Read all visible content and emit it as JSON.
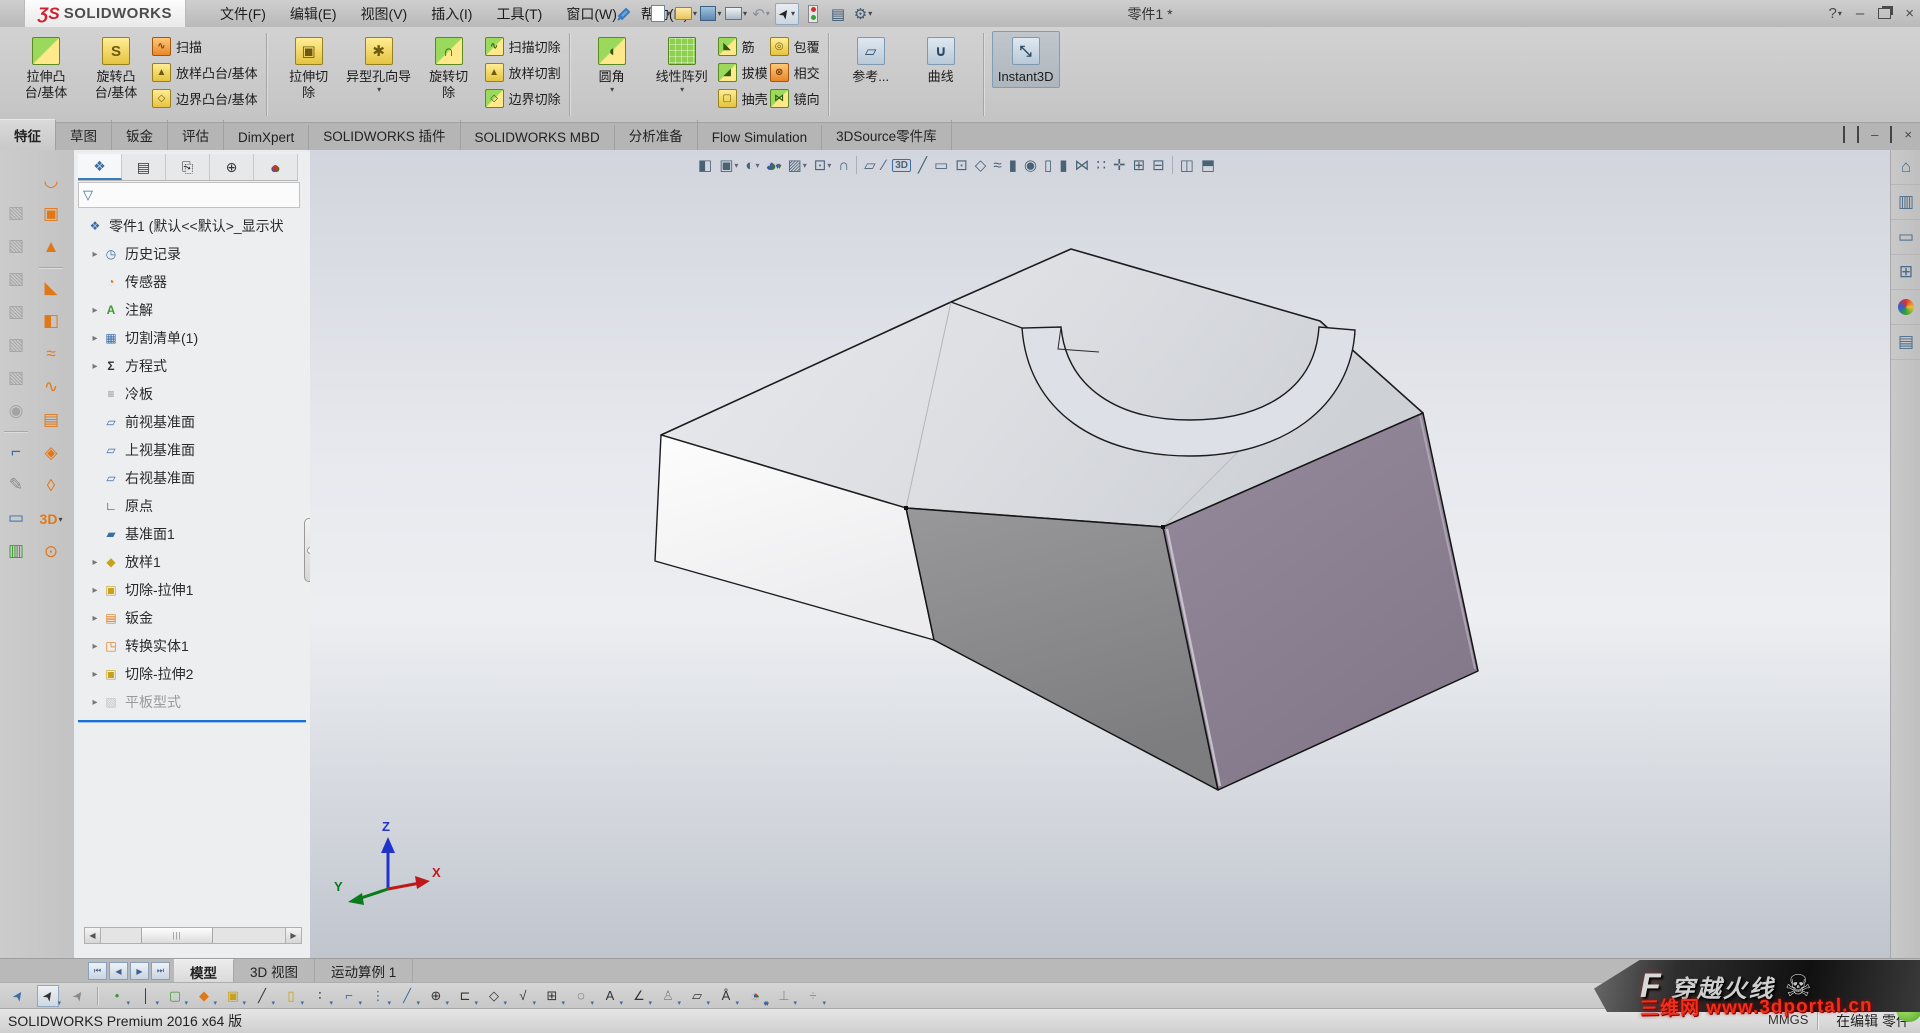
{
  "titlebar": {
    "logo_mark": "ƷS",
    "logo_text": "SOLIDWORKS",
    "menus": [
      "文件(F)",
      "编辑(E)",
      "视图(V)",
      "插入(I)",
      "工具(T)",
      "窗口(W)",
      "帮助(H)"
    ],
    "document_title": "零件1 *",
    "help_label": "?",
    "minimize_label": "–",
    "close_label": "×"
  },
  "quick_access": [
    {
      "n": "new-document-button",
      "c": "qi-new",
      "shape": true,
      "caret": true
    },
    {
      "n": "open-button",
      "c": "qi-open",
      "shape": true,
      "caret": true
    },
    {
      "n": "save-button",
      "c": "qi-save",
      "shape": true,
      "caret": true
    },
    {
      "n": "print-button",
      "c": "qi-print",
      "shape": true,
      "caret": true
    },
    {
      "n": "undo-button",
      "c": "qi-undo",
      "g": "↶",
      "caret": true,
      "disabled": true
    },
    {
      "n": "select-button",
      "c": "qi-pointer",
      "g": "➤",
      "boxed": true,
      "caret": true
    },
    {
      "n": "rebuild-button",
      "c": "qi-rebuild",
      "traffic": true
    },
    {
      "n": "options-list-button",
      "c": "qi-list",
      "g": "▤"
    },
    {
      "n": "settings-button",
      "c": "qi-gear",
      "g": "⚙",
      "caret": true
    }
  ],
  "ribbon": {
    "groups": [
      {
        "items": [
          {
            "type": "big",
            "name": "extrude-boss-button",
            "lines": [
              "拉伸凸",
              "台/基体"
            ],
            "icon": "extrude-boss-icon",
            "iconcls": "ribg",
            "glyph": ""
          },
          {
            "type": "big",
            "name": "revolve-boss-button",
            "lines": [
              "旋转凸",
              "台/基体"
            ],
            "icon": "revolve-boss-icon",
            "iconcls": "riby",
            "glyph": "S"
          },
          {
            "type": "col",
            "items": [
              {
                "name": "sweep-button",
                "label": "扫描",
                "icon": "sweep-icon",
                "iconcls": "ribo",
                "glyph": "∿"
              },
              {
                "name": "loft-button",
                "label": "放样凸台/基体",
                "icon": "loft-icon",
                "iconcls": "riby",
                "glyph": "▲"
              },
              {
                "name": "boundary-boss-button",
                "label": "边界凸台/基体",
                "icon": "boundary-boss-icon",
                "iconcls": "riby",
                "glyph": "◇"
              }
            ]
          }
        ]
      },
      {
        "items": [
          {
            "type": "big",
            "name": "extrude-cut-button",
            "lines": [
              "拉伸切",
              "除"
            ],
            "icon": "extrude-cut-icon",
            "iconcls": "riby",
            "glyph": "▣"
          },
          {
            "type": "big",
            "name": "hole-wizard-button",
            "lines": [
              "异型孔向导"
            ],
            "icon": "hole-wizard-icon",
            "iconcls": "riby",
            "glyph": "✱",
            "caret": true
          },
          {
            "type": "big",
            "name": "revolve-cut-button",
            "lines": [
              "旋转切",
              "除"
            ],
            "icon": "revolve-cut-icon",
            "iconcls": "ribg",
            "glyph": "∩"
          },
          {
            "type": "col",
            "items": [
              {
                "name": "sweep-cut-button",
                "label": "扫描切除",
                "icon": "sweep-cut-icon",
                "iconcls": "ribg",
                "glyph": "∿"
              },
              {
                "name": "loft-cut-button",
                "label": "放样切割",
                "icon": "loft-cut-icon",
                "iconcls": "riby",
                "glyph": "▲"
              },
              {
                "name": "boundary-cut-button",
                "label": "边界切除",
                "icon": "boundary-cut-icon",
                "iconcls": "ribg",
                "glyph": "◇"
              }
            ]
          }
        ]
      },
      {
        "items": [
          {
            "type": "big",
            "name": "fillet-button",
            "lines": [
              "圆角"
            ],
            "icon": "fillet-icon",
            "iconcls": "ribg",
            "glyph": "◖",
            "caret": true
          },
          {
            "type": "big",
            "name": "linear-pattern-button",
            "lines": [
              "线性阵列"
            ],
            "icon": "linear-pattern-icon",
            "iconcls": "ribg2",
            "glyph": "",
            "caret": true
          },
          {
            "type": "col",
            "items": [
              {
                "name": "rib-button",
                "label": "筋",
                "icon": "rib-icon",
                "iconcls": "ribg",
                "glyph": "◣"
              },
              {
                "name": "draft-button",
                "label": "拔模",
                "icon": "draft-icon",
                "iconcls": "ribg",
                "glyph": "◢"
              },
              {
                "name": "shell-button",
                "label": "抽壳",
                "icon": "shell-icon",
                "iconcls": "riby",
                "glyph": "▢"
              }
            ]
          },
          {
            "type": "col",
            "items": [
              {
                "name": "wrap-button",
                "label": "包覆",
                "icon": "wrap-icon",
                "iconcls": "riby",
                "glyph": "◎"
              },
              {
                "name": "intersect-button",
                "label": "相交",
                "icon": "intersect-icon",
                "iconcls": "ribo",
                "glyph": "⊗"
              },
              {
                "name": "mirror-button",
                "label": "镜向",
                "icon": "mirror-icon",
                "iconcls": "ribg",
                "glyph": "⋈"
              }
            ]
          }
        ]
      },
      {
        "items": [
          {
            "type": "big",
            "name": "reference-geometry-button",
            "lines": [
              "参考..."
            ],
            "icon": "reference-geometry-icon",
            "iconcls": "ribb",
            "glyph": "▱"
          },
          {
            "type": "big",
            "name": "curves-button",
            "lines": [
              "曲线"
            ],
            "icon": "curves-icon",
            "iconcls": "ribb",
            "glyph": "∪"
          }
        ]
      },
      {
        "items": [
          {
            "type": "big",
            "name": "instant3d-button",
            "lines": [
              "Instant3D"
            ],
            "icon": "instant3d-icon",
            "iconcls": "ribb",
            "glyph": "⤡",
            "active": true
          }
        ]
      }
    ]
  },
  "command_tabs": {
    "active_index": 0,
    "tabs": [
      "特征",
      "草图",
      "钣金",
      "评估",
      "DimXpert",
      "SOLIDWORKS 插件",
      "SOLIDWORKS MBD",
      "分析准备",
      "Flow Simulation",
      "3DSource零件库"
    ]
  },
  "feature_tree": {
    "root_label": "零件1 (默认<<默认>_显示状",
    "items": [
      {
        "label": "历史记录",
        "icon": "history-icon",
        "g": "◷",
        "c": "c-blue",
        "arrow": true
      },
      {
        "label": "传感器",
        "icon": "sensors-icon",
        "g": "◔",
        "c": "c-orange",
        "arrow": false
      },
      {
        "label": "注解",
        "icon": "annotations-icon",
        "g": "A",
        "c": "c-green",
        "arrow": true
      },
      {
        "label": "切割清单(1)",
        "icon": "cut-list-icon",
        "g": "▦",
        "c": "c-blue",
        "arrow": true
      },
      {
        "label": "方程式",
        "icon": "equations-icon",
        "g": "Σ",
        "c": "c-dark",
        "arrow": true
      },
      {
        "label": "冷板",
        "icon": "material-icon",
        "g": "≡",
        "c": "c-gray",
        "arrow": false
      },
      {
        "label": "前视基准面",
        "icon": "front-plane-icon",
        "g": "▱",
        "c": "c-blue",
        "arrow": false
      },
      {
        "label": "上视基准面",
        "icon": "top-plane-icon",
        "g": "▱",
        "c": "c-blue",
        "arrow": false
      },
      {
        "label": "右视基准面",
        "icon": "right-plane-icon",
        "g": "▱",
        "c": "c-blue",
        "arrow": false
      },
      {
        "label": "原点",
        "icon": "origin-icon",
        "g": "∟",
        "c": "c-dark",
        "arrow": false
      },
      {
        "label": "基准面1",
        "icon": "plane-icon",
        "g": "▰",
        "c": "c-blue",
        "arrow": false
      },
      {
        "label": "放样1",
        "icon": "loft-feature-icon",
        "g": "◆",
        "c": "c-yellow",
        "arrow": true
      },
      {
        "label": "切除-拉伸1",
        "icon": "cut-extrude-icon",
        "g": "▣",
        "c": "c-yellow",
        "arrow": true
      },
      {
        "label": "钣金",
        "icon": "sheet-metal-icon",
        "g": "▤",
        "c": "c-orange",
        "arrow": true
      },
      {
        "label": "转换实体1",
        "icon": "convert-solid-icon",
        "g": "◳",
        "c": "c-orange",
        "arrow": true
      },
      {
        "label": "切除-拉伸2",
        "icon": "cut-extrude-icon",
        "g": "▣",
        "c": "c-yellow",
        "arrow": true
      },
      {
        "label": "平板型式",
        "icon": "flat-pattern-icon",
        "g": "▧",
        "c": "c-gray",
        "arrow": true,
        "grayed": true
      }
    ]
  },
  "panel_tabs": [
    {
      "n": "featuremanager-tab",
      "g": "❖",
      "c": "c-blue",
      "active": true
    },
    {
      "n": "propertymanager-tab",
      "g": "▤",
      "c": "c-dark"
    },
    {
      "n": "configurationmanager-tab",
      "g": "⎘",
      "c": "c-dark"
    },
    {
      "n": "dimxpertmanager-tab",
      "g": "⊕",
      "c": "c-dark"
    },
    {
      "n": "displaymanager-tab",
      "g": "●",
      "c": "c-multi"
    }
  ],
  "headsup_toolbar": [
    {
      "n": "section-view-icon",
      "g": "◧"
    },
    {
      "n": "view-orientation-icon",
      "g": "▣",
      "caret": true
    },
    {
      "n": "display-style-icon",
      "g": "◐",
      "caret": true
    },
    {
      "n": "appearances-icon",
      "g": "◕",
      "c": "c-multi",
      "caret": true
    },
    {
      "n": "scene-icon",
      "g": "▨",
      "caret": true
    },
    {
      "n": "view-settings-icon",
      "g": "⊡",
      "caret": true
    },
    {
      "n": "freeze-bar-icon",
      "g": "∩",
      "c": "c-gray"
    },
    {
      "sep": true
    },
    {
      "n": "plane-icon",
      "g": "▱",
      "c": "c-blue"
    },
    {
      "n": "centerline-icon",
      "g": "∕",
      "c": "c-blue"
    },
    {
      "n": "sketch-3d-icon",
      "g": "3D",
      "c": "c-blue",
      "box3d": true
    },
    {
      "n": "line-icon",
      "g": "╱",
      "c": "c-dark"
    },
    {
      "n": "corner-rectangle-icon",
      "g": "▭",
      "c": "c-dark"
    },
    {
      "n": "center-rectangle-icon",
      "g": "⊡",
      "c": "c-dark"
    },
    {
      "n": "polygon-icon",
      "g": "◇",
      "c": "c-dark"
    },
    {
      "n": "spline-icon",
      "g": "≈",
      "c": "c-dark"
    },
    {
      "n": "extrude-tool-icon",
      "g": "▮",
      "c": "c-gray"
    },
    {
      "n": "revolve-tool-icon",
      "g": "◉",
      "c": "c-yellow"
    },
    {
      "n": "sweep-tool-icon",
      "g": "▯",
      "c": "c-gray"
    },
    {
      "n": "cut-tool-icon",
      "g": "▮",
      "c": "c-yellow"
    },
    {
      "n": "mirror-tool-icon",
      "g": "⋈",
      "c": "c-green"
    },
    {
      "n": "pattern-tool-icon",
      "g": "∷",
      "c": "c-green"
    },
    {
      "n": "move-face-icon",
      "g": "✛",
      "c": "c-gray"
    },
    {
      "n": "instant2d-icon",
      "g": "⊞",
      "c": "c-gray"
    },
    {
      "n": "hide-show-icon",
      "g": "⊟",
      "c": "c-gray"
    },
    {
      "sep": true
    },
    {
      "n": "split-horizontal-icon",
      "g": "◫",
      "c": "c-dark"
    },
    {
      "n": "split-vertical-icon",
      "g": "⬒",
      "c": "c-dark"
    }
  ],
  "left_outer_toolbar": [
    {
      "n": "toolbar-cube-icon",
      "g": "▧"
    },
    {
      "n": "toolbar-cube-icon",
      "g": "▧"
    },
    {
      "n": "toolbar-cube-icon",
      "g": "▧"
    },
    {
      "n": "toolbar-cube-icon",
      "g": "▧"
    },
    {
      "n": "toolbar-cube-icon",
      "g": "▧"
    },
    {
      "n": "toolbar-cube-icon",
      "g": "▧"
    },
    {
      "n": "toolbar-sphere-icon",
      "g": "◉"
    },
    {
      "sep": true
    },
    {
      "n": "sketch-entity-icon",
      "g": "⌐",
      "c": "c-blue"
    },
    {
      "n": "edit-tool-icon",
      "g": "✎",
      "c": "c-gray"
    },
    {
      "n": "rapid-sketch-icon",
      "g": "▭",
      "c": "c-blue"
    },
    {
      "n": "extrude-mini-icon",
      "g": "▥",
      "c": "c-green"
    }
  ],
  "left_inner_toolbar": [
    {
      "n": "base-flange-icon",
      "g": "◡",
      "c": "c-orange"
    },
    {
      "n": "convert-to-sheetmetal-icon",
      "g": "▣",
      "c": "c-orange"
    },
    {
      "n": "lofted-bend-icon",
      "g": "▲",
      "c": "c-orange"
    },
    {
      "sep": true
    },
    {
      "n": "edge-flange-icon",
      "g": "◣",
      "c": "c-orange"
    },
    {
      "n": "miter-flange-icon",
      "g": "◧",
      "c": "c-orange"
    },
    {
      "n": "hem-icon",
      "g": "≈",
      "c": "c-orange"
    },
    {
      "n": "jog-icon",
      "g": "∿",
      "c": "c-orange"
    },
    {
      "n": "sketched-bend-icon",
      "g": "▤",
      "c": "c-orange"
    },
    {
      "n": "cross-break-icon",
      "g": "◈",
      "c": "c-orange"
    },
    {
      "n": "corner-icon",
      "g": "◊",
      "c": "c-orange"
    },
    {
      "n": "3d-cube-icon",
      "g": "3D",
      "c": "c-orange",
      "caret": true
    },
    {
      "n": "vent-icon",
      "g": "⊙",
      "c": "c-orange"
    }
  ],
  "right_pane": [
    {
      "n": "home-icon",
      "g": "⌂"
    },
    {
      "n": "design-library-icon",
      "g": "▥"
    },
    {
      "n": "file-explorer-icon",
      "g": "▭"
    },
    {
      "n": "view-palette-icon",
      "g": "⊞"
    },
    {
      "n": "appearances-sphere-icon",
      "g": "●",
      "rainbow": true
    },
    {
      "n": "custom-properties-icon",
      "g": "▤"
    }
  ],
  "bottom_tabs": {
    "active_index": 0,
    "tabs": [
      "模型",
      "3D 视图",
      "运动算例 1"
    ],
    "nav": [
      "⏮",
      "◀",
      "▶",
      "⏭"
    ]
  },
  "sketch_toolbar": [
    {
      "n": "select-multiple-icon",
      "g": "➤",
      "c": "c-blue"
    },
    {
      "n": "select-pointer-icon",
      "g": "➤",
      "c": "c-dark",
      "boxed": true,
      "caret": true
    },
    {
      "n": "lasso-icon",
      "g": "➤",
      "c": "c-gray"
    },
    {
      "sep": true
    },
    {
      "n": "point-icon",
      "g": "•",
      "c": "c-green",
      "mini": true
    },
    {
      "n": "centerline-icon",
      "g": "│",
      "c": "c-dark",
      "mini": true
    },
    {
      "n": "plane-tool-icon",
      "g": "▢",
      "c": "c-green",
      "mini": true
    },
    {
      "n": "surface-icon",
      "g": "◆",
      "c": "c-orange",
      "mini": true
    },
    {
      "n": "solid-icon",
      "g": "▣",
      "c": "c-yellow",
      "mini": true
    },
    {
      "n": "line-tool-icon",
      "g": "╱",
      "c": "c-dark",
      "mini": true
    },
    {
      "n": "extrude-mini-icon",
      "g": "▯",
      "c": "c-yellow",
      "mini": true
    },
    {
      "n": "point-pair-icon",
      "g": "∶",
      "c": "c-dark",
      "mini": true
    },
    {
      "n": "corner-icon",
      "g": "⌐",
      "c": "c-blue",
      "mini": true
    },
    {
      "n": "polyline-icon",
      "g": "⋮",
      "c": "c-blue",
      "mini": true
    },
    {
      "n": "slash-icon",
      "g": "╱",
      "c": "c-blue",
      "mini": true
    },
    {
      "n": "circle-icon",
      "g": "⊕",
      "c": "c-dark",
      "mini": true
    },
    {
      "n": "slot-icon",
      "g": "⊏",
      "c": "c-dark",
      "mini": true
    },
    {
      "n": "polygon-tool-icon",
      "g": "◇",
      "c": "c-dark",
      "mini": true
    },
    {
      "n": "check-icon",
      "g": "√",
      "c": "c-dark",
      "mini": true
    },
    {
      "n": "dimension-icon",
      "g": "⊞",
      "c": "c-dark",
      "mini": true
    },
    {
      "n": "magnify-icon",
      "g": "◌",
      "c": "c-dark",
      "mini": true
    },
    {
      "n": "note-icon",
      "g": "A",
      "c": "c-dark",
      "mini": true
    },
    {
      "n": "angle-icon",
      "g": "∠",
      "c": "c-dark",
      "mini": true
    },
    {
      "n": "balloon-icon",
      "g": "♙",
      "c": "c-gray",
      "mini": true
    },
    {
      "n": "datum-icon",
      "g": "▱",
      "c": "c-dark",
      "mini": true
    },
    {
      "n": "annotation-icon",
      "g": "Å",
      "c": "c-dark",
      "mini": true
    },
    {
      "n": "pie-icon",
      "g": "◔",
      "c": "c-multi",
      "mini": true
    },
    {
      "n": "trim-icon",
      "g": "⊥",
      "c": "c-gray",
      "mini": true
    },
    {
      "n": "extend-icon",
      "g": "÷",
      "c": "c-gray",
      "mini": true
    }
  ],
  "status_bar": {
    "left": "SOLIDWORKS Premium 2016 x64 版",
    "editing": "在编辑 零件",
    "units": "MMGS"
  },
  "watermark": {
    "mark": "F",
    "game": "穿越火线",
    "skull": "☠",
    "site": "三维网 www.3dportal.cn"
  },
  "triad": {
    "x": "X",
    "y": "Y",
    "z": "Z"
  }
}
